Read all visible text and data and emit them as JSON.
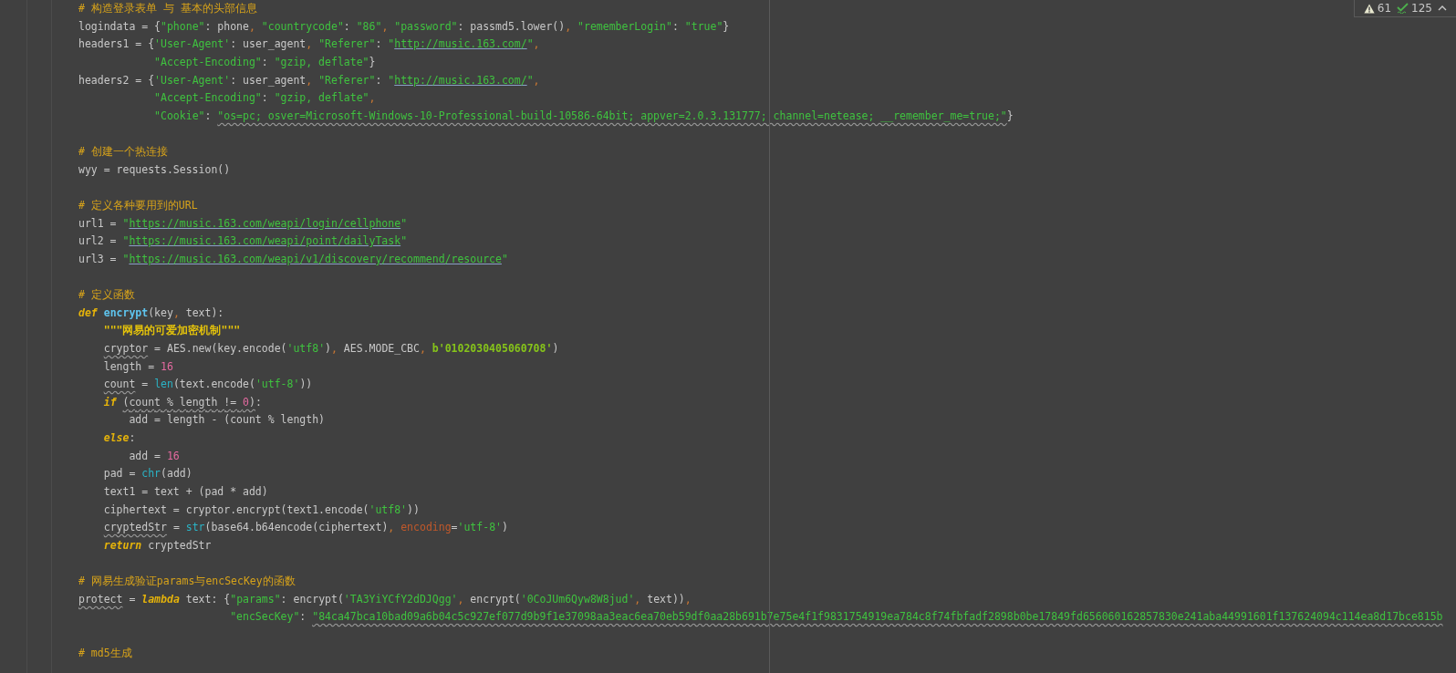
{
  "inspections": {
    "warnings": "61",
    "weak_warnings": "125"
  },
  "lines": [
    {
      "kind": "code",
      "tokens": [
        {
          "text": "# 构造登录表单 与 基本的头部信息",
          "kind": "comment"
        }
      ]
    },
    {
      "kind": "code",
      "tokens": [
        {
          "text": "logindata = {",
          "kind": "plain"
        },
        {
          "text": "\"phone\"",
          "kind": "string"
        },
        {
          "text": ": phone",
          "kind": "plain"
        },
        {
          "text": ", ",
          "kind": "punct"
        },
        {
          "text": "\"countrycode\"",
          "kind": "string"
        },
        {
          "text": ": ",
          "kind": "plain"
        },
        {
          "text": "\"86\"",
          "kind": "string"
        },
        {
          "text": ", ",
          "kind": "punct"
        },
        {
          "text": "\"password\"",
          "kind": "string"
        },
        {
          "text": ": passmd5.lower()",
          "kind": "plain"
        },
        {
          "text": ", ",
          "kind": "punct"
        },
        {
          "text": "\"rememberLogin\"",
          "kind": "string"
        },
        {
          "text": ": ",
          "kind": "plain"
        },
        {
          "text": "\"true\"",
          "kind": "string"
        },
        {
          "text": "}",
          "kind": "plain"
        }
      ]
    },
    {
      "kind": "code",
      "tokens": [
        {
          "text": "headers1 = {",
          "kind": "plain"
        },
        {
          "text": "'User-Agent'",
          "kind": "string"
        },
        {
          "text": ": user_agent",
          "kind": "plain"
        },
        {
          "text": ", ",
          "kind": "punct"
        },
        {
          "text": "\"Referer\"",
          "kind": "string"
        },
        {
          "text": ": ",
          "kind": "plain"
        },
        {
          "text": "\"",
          "kind": "string"
        },
        {
          "text": "http://music.163.com/",
          "kind": "url"
        },
        {
          "text": "\"",
          "kind": "string"
        },
        {
          "text": ",",
          "kind": "punct"
        }
      ]
    },
    {
      "kind": "code",
      "tokens": [
        {
          "text": "            \"Accept-Encoding\"",
          "kind": "string"
        },
        {
          "text": ": ",
          "kind": "plain"
        },
        {
          "text": "\"gzip, deflate\"",
          "kind": "string"
        },
        {
          "text": "}",
          "kind": "plain"
        }
      ]
    },
    {
      "kind": "code",
      "tokens": [
        {
          "text": "headers2 = {",
          "kind": "plain"
        },
        {
          "text": "'User-Agent'",
          "kind": "string"
        },
        {
          "text": ": user_agent",
          "kind": "plain"
        },
        {
          "text": ", ",
          "kind": "punct"
        },
        {
          "text": "\"Referer\"",
          "kind": "string"
        },
        {
          "text": ": ",
          "kind": "plain"
        },
        {
          "text": "\"",
          "kind": "string"
        },
        {
          "text": "http://music.163.com/",
          "kind": "url"
        },
        {
          "text": "\"",
          "kind": "string"
        },
        {
          "text": ",",
          "kind": "punct"
        }
      ]
    },
    {
      "kind": "code",
      "tokens": [
        {
          "text": "            \"Accept-Encoding\"",
          "kind": "string"
        },
        {
          "text": ": ",
          "kind": "plain"
        },
        {
          "text": "\"gzip, deflate\"",
          "kind": "string"
        },
        {
          "text": ",",
          "kind": "punct"
        }
      ]
    },
    {
      "kind": "code",
      "tokens": [
        {
          "text": "            \"Cookie\"",
          "kind": "string"
        },
        {
          "text": ": ",
          "kind": "plain"
        },
        {
          "text": "\"os=pc; osver=Microsoft-Windows-10-Professional-build-10586-64bit; appver=2.0.3.131777; channel=netease; __remember_me=true;\"",
          "kind": "string",
          "warn": true
        },
        {
          "text": "}",
          "kind": "plain"
        }
      ]
    },
    {
      "kind": "blank"
    },
    {
      "kind": "code",
      "tokens": [
        {
          "text": "# 创建一个热连接",
          "kind": "comment"
        }
      ]
    },
    {
      "kind": "code",
      "tokens": [
        {
          "text": "wyy = requests.Session()",
          "kind": "plain"
        }
      ]
    },
    {
      "kind": "blank"
    },
    {
      "kind": "code",
      "tokens": [
        {
          "text": "# 定义各种要用到的URL",
          "kind": "comment"
        }
      ]
    },
    {
      "kind": "code",
      "tokens": [
        {
          "text": "url1 = ",
          "kind": "plain"
        },
        {
          "text": "\"",
          "kind": "string"
        },
        {
          "text": "https://music.163.com/weapi/login/cellphone",
          "kind": "url"
        },
        {
          "text": "\"",
          "kind": "string"
        }
      ]
    },
    {
      "kind": "code",
      "tokens": [
        {
          "text": "url2 = ",
          "kind": "plain"
        },
        {
          "text": "\"",
          "kind": "string"
        },
        {
          "text": "https://music.163.com/weapi/point/dailyTask",
          "kind": "url"
        },
        {
          "text": "\"",
          "kind": "string"
        }
      ]
    },
    {
      "kind": "code",
      "tokens": [
        {
          "text": "url3 = ",
          "kind": "plain"
        },
        {
          "text": "\"",
          "kind": "string"
        },
        {
          "text": "https://music.163.com/weapi/v1/discovery/recommend/resource",
          "kind": "url"
        },
        {
          "text": "\"",
          "kind": "string"
        }
      ]
    },
    {
      "kind": "blank"
    },
    {
      "kind": "code",
      "tokens": [
        {
          "text": "# 定义函数",
          "kind": "comment"
        }
      ]
    },
    {
      "kind": "code",
      "tokens": [
        {
          "text": "def",
          "kind": "keyword"
        },
        {
          "text": " encrypt",
          "kind": "function"
        },
        {
          "text": "(key",
          "kind": "plain"
        },
        {
          "text": ", ",
          "kind": "punct"
        },
        {
          "text": "text):",
          "kind": "plain"
        }
      ]
    },
    {
      "kind": "code",
      "tokens": [
        {
          "text": "    \"\"\"网易的可爱加密机制\"\"\"",
          "kind": "docstring"
        }
      ]
    },
    {
      "kind": "code",
      "tokens": [
        {
          "text": "    cryptor",
          "kind": "plain",
          "warn": true
        },
        {
          "text": " = AES.new(key.encode(",
          "kind": "plain"
        },
        {
          "text": "'utf8'",
          "kind": "string"
        },
        {
          "text": ")",
          "kind": "plain"
        },
        {
          "text": ", ",
          "kind": "punct"
        },
        {
          "text": "AES.MODE_CBC",
          "kind": "plain"
        },
        {
          "text": ", ",
          "kind": "punct"
        },
        {
          "text": "b'0102030405060708'",
          "kind": "bytes"
        },
        {
          "text": ")",
          "kind": "plain"
        }
      ]
    },
    {
      "kind": "code",
      "tokens": [
        {
          "text": "    length = ",
          "kind": "plain"
        },
        {
          "text": "16",
          "kind": "number"
        }
      ]
    },
    {
      "kind": "code",
      "tokens": [
        {
          "text": "    count",
          "kind": "plain",
          "warn": true
        },
        {
          "text": " = ",
          "kind": "plain"
        },
        {
          "text": "len",
          "kind": "builtin"
        },
        {
          "text": "(text.encode(",
          "kind": "plain"
        },
        {
          "text": "'utf-8'",
          "kind": "string"
        },
        {
          "text": "))",
          "kind": "plain"
        }
      ]
    },
    {
      "kind": "code",
      "tokens": [
        {
          "text": "    if",
          "kind": "keyword"
        },
        {
          "text": " (count % length != ",
          "kind": "plain",
          "warn": true
        },
        {
          "text": "0",
          "kind": "number",
          "warn": true
        },
        {
          "text": ")",
          "kind": "plain",
          "warn": true
        },
        {
          "text": ":",
          "kind": "plain"
        }
      ]
    },
    {
      "kind": "code",
      "tokens": [
        {
          "text": "        add = length - (count % length)",
          "kind": "plain"
        }
      ]
    },
    {
      "kind": "code",
      "tokens": [
        {
          "text": "    else",
          "kind": "keyword"
        },
        {
          "text": ":",
          "kind": "plain"
        }
      ]
    },
    {
      "kind": "code",
      "tokens": [
        {
          "text": "        add = ",
          "kind": "plain"
        },
        {
          "text": "16",
          "kind": "number"
        }
      ]
    },
    {
      "kind": "code",
      "tokens": [
        {
          "text": "    pad = ",
          "kind": "plain"
        },
        {
          "text": "chr",
          "kind": "builtin"
        },
        {
          "text": "(add)",
          "kind": "plain"
        }
      ]
    },
    {
      "kind": "code",
      "tokens": [
        {
          "text": "    text1 = text + (pad * add)",
          "kind": "plain"
        }
      ]
    },
    {
      "kind": "code",
      "tokens": [
        {
          "text": "    ciphertext = cryptor.encrypt(text1.encode(",
          "kind": "plain"
        },
        {
          "text": "'utf8'",
          "kind": "string"
        },
        {
          "text": "))",
          "kind": "plain"
        }
      ]
    },
    {
      "kind": "code",
      "tokens": [
        {
          "text": "    cryptedStr",
          "kind": "plain",
          "warn": true
        },
        {
          "text": " = ",
          "kind": "plain"
        },
        {
          "text": "str",
          "kind": "builtin"
        },
        {
          "text": "(base64.b64encode(ciphertext)",
          "kind": "plain"
        },
        {
          "text": ", ",
          "kind": "punct"
        },
        {
          "text": "encoding",
          "kind": "param"
        },
        {
          "text": "=",
          "kind": "plain"
        },
        {
          "text": "'utf-8'",
          "kind": "string"
        },
        {
          "text": ")",
          "kind": "plain"
        }
      ]
    },
    {
      "kind": "code",
      "tokens": [
        {
          "text": "    return",
          "kind": "keyword"
        },
        {
          "text": " cryptedStr",
          "kind": "plain"
        }
      ]
    },
    {
      "kind": "blank"
    },
    {
      "kind": "code",
      "tokens": [
        {
          "text": "# 网易生成验证params与encSecKey的函数",
          "kind": "comment"
        }
      ]
    },
    {
      "kind": "code",
      "tokens": [
        {
          "text": "protect",
          "kind": "plain",
          "warn": true
        },
        {
          "text": " = ",
          "kind": "plain"
        },
        {
          "text": "lambda",
          "kind": "keyword"
        },
        {
          "text": " text: {",
          "kind": "plain"
        },
        {
          "text": "\"params\"",
          "kind": "string"
        },
        {
          "text": ": encrypt(",
          "kind": "plain"
        },
        {
          "text": "'TA3YiYCfY2dDJQgg'",
          "kind": "string"
        },
        {
          "text": ", ",
          "kind": "punct"
        },
        {
          "text": "encrypt(",
          "kind": "plain"
        },
        {
          "text": "'0CoJUm6Qyw8W8jud'",
          "kind": "string"
        },
        {
          "text": ", ",
          "kind": "punct"
        },
        {
          "text": "text))",
          "kind": "plain"
        },
        {
          "text": ",",
          "kind": "punct"
        }
      ]
    },
    {
      "kind": "code",
      "tokens": [
        {
          "text": "                        \"encSecKey\"",
          "kind": "string"
        },
        {
          "text": ": ",
          "kind": "plain"
        },
        {
          "text": "\"84ca47bca10bad09a6b04c5c927ef077d9b9f1e37098aa3eac6ea70eb59df0aa28b691b7e75e4f1f9831754919ea784c8f74fbfadf2898b0be17849fd656060162857830e241aba44991601f137624094c114ea8d17bce815b",
          "kind": "string",
          "warn": true
        }
      ]
    },
    {
      "kind": "blank"
    },
    {
      "kind": "code",
      "tokens": [
        {
          "text": "# md5生成",
          "kind": "comment"
        }
      ]
    }
  ]
}
